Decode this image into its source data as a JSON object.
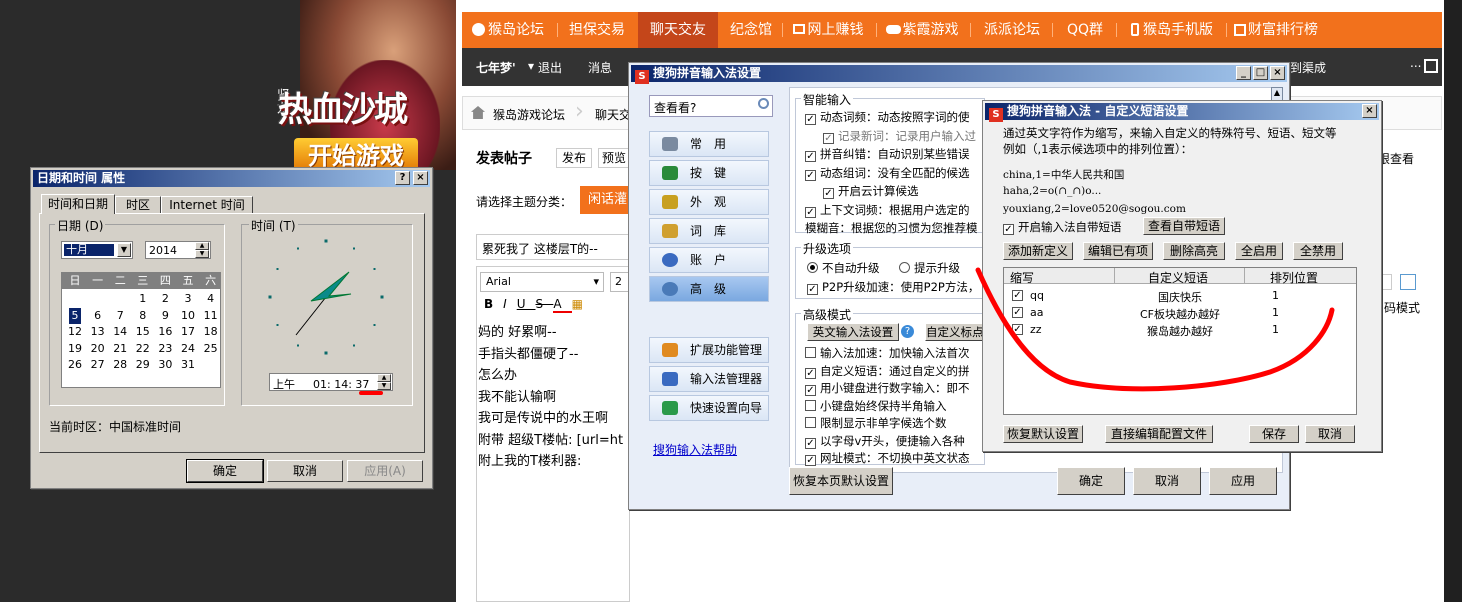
{
  "banner": {
    "game_logo": "热血沙城",
    "game_logo_prefix": "贤龙",
    "start_button": "开始游戏"
  },
  "forum": {
    "nav": [
      "猴岛论坛",
      "担保交易",
      "聊天交友",
      "纪念馆",
      "网上赚钱",
      "紫霞游戏",
      "派派论坛",
      "QQ群",
      "猴岛手机版",
      "财富排行榜"
    ],
    "active_nav": "聊天交友",
    "user": {
      "name": "七年梦'",
      "logout": "退出",
      "messages": "消息",
      "extra": "到渠成",
      "ellipsis": "..."
    },
    "breadcrumb": [
      "猴岛游戏论坛",
      "聊天交"
    ],
    "post_title_label": "发表帖子",
    "publish_btn": "发布",
    "preview_btn": "预览",
    "perm_view": "限查看",
    "category_label": "请选择主题分类：",
    "category_value": "闲话灌",
    "subject": "累死我了 这楼层T的-- ",
    "font_name": "Arial",
    "font_size": "2",
    "code_mode": "码模式",
    "body_lines": [
      "妈的 好累啊--",
      "手指头都僵硬了--",
      "怎么办",
      "我不能认输啊",
      "我可是传说中的水王啊",
      "附带 超级T楼帖: [url=ht",
      "附上我的T楼利器:"
    ]
  },
  "datetime_window": {
    "title": "日期和时间 属性",
    "tabs": [
      "时间和日期",
      "时区",
      "Internet 时间"
    ],
    "date_label": "日期 (D)",
    "time_label": "时间 (T)",
    "month": "十月",
    "year": "2014",
    "weekdays": [
      "日",
      "一",
      "二",
      "三",
      "四",
      "五",
      "六"
    ],
    "days": [
      "1",
      "2",
      "3",
      "4",
      "5",
      "6",
      "7",
      "8",
      "9",
      "10",
      "11",
      "12",
      "13",
      "14",
      "15",
      "16",
      "17",
      "18",
      "19",
      "20",
      "21",
      "22",
      "23",
      "24",
      "25",
      "26",
      "27",
      "28",
      "29",
      "30",
      "31"
    ],
    "selected_day": "5",
    "ampm": "上午",
    "time": "01: 14: 37",
    "timezone": "当前时区：中国标准时间",
    "ok": "确定",
    "cancel": "取消",
    "apply": "应用(A)"
  },
  "sogou_settings": {
    "title": "搜狗拼音输入法设置",
    "search_placeholder": "查看看?",
    "sections": [
      "常用",
      "按键",
      "外观",
      "词库",
      "账户",
      "高级"
    ],
    "selected_section": "高级",
    "extra_items": [
      "扩展功能管理",
      "输入法管理器",
      "快速设置向导"
    ],
    "help_link": "搜狗输入法帮助",
    "smart_input_label": "智能输入",
    "smart_input": [
      {
        "checked": true,
        "text": "动态词频：动态按照字词的使"
      },
      {
        "checked": true,
        "indent": true,
        "text": "记录新词：记录用户输入过"
      },
      {
        "checked": true,
        "text": "拼音纠错：自动识别某些错误"
      },
      {
        "checked": true,
        "text": "动态组词：没有全匹配的候选"
      },
      {
        "checked": true,
        "indent": true,
        "text": "开启云计算候选"
      },
      {
        "checked": true,
        "text": "上下文词频：根据用户选定的"
      },
      {
        "checked": false,
        "text": "模糊音：根据您的习惯为您推荐模"
      }
    ],
    "upgrade_label": "升级选项",
    "upgrade_options": [
      "不自动升级",
      "提示升级"
    ],
    "p2p": "P2P升级加速：使用P2P方法，",
    "advanced_label": "高级模式",
    "adv_buttons": [
      "英文输入法设置",
      "自定义标点"
    ],
    "advanced": [
      {
        "checked": false,
        "text": "输入法加速：加快输入法首次"
      },
      {
        "checked": true,
        "text": "自定义短语：通过自定义的拼"
      },
      {
        "checked": true,
        "text": "用小键盘进行数字输入：即不"
      },
      {
        "checked": false,
        "text": "小键盘始终保持半角输入"
      },
      {
        "checked": false,
        "text": "限制显示非单字候选个数"
      },
      {
        "checked": true,
        "text": "以字母v开头，便捷输入各种"
      },
      {
        "checked": true,
        "text": "网址模式：不切换中英文状态"
      }
    ],
    "restore": "恢复本页默认设置",
    "ok": "确定",
    "cancel": "取消",
    "apply": "应用"
  },
  "phrase_dialog": {
    "title": "搜狗拼音输入法 - 自定义短语设置",
    "desc1": "通过英文字符作为缩写，来输入自定义的特殊符号、短语、短文等",
    "desc2": "例如（,1表示候选项中的排列位置）：",
    "examples": [
      "china,1=中华人民共和国",
      "haha,2=o(∩_∩)o...",
      "youxiang,2=love0520@sogou.com"
    ],
    "enable_builtin": "开启输入法自带短语",
    "view_builtin": "查看自带短语",
    "buttons": [
      "添加新定义",
      "编辑已有项",
      "删除高亮",
      "全启用",
      "全禁用"
    ],
    "columns": [
      "缩写",
      "自定义短语",
      "排列位置"
    ],
    "rows": [
      {
        "abbr": "qq",
        "phrase": "国庆快乐",
        "pos": "1"
      },
      {
        "abbr": "aa",
        "phrase": "CF板块越办越好",
        "pos": "1"
      },
      {
        "abbr": "zz",
        "phrase": "猴岛越办越好",
        "pos": "1"
      }
    ],
    "restore": "恢复默认设置",
    "edit_file": "直接编辑配置文件",
    "save": "保存",
    "cancel": "取消"
  },
  "colors": {
    "forum_orange": "#f2711c",
    "title_blue": "#0a246a",
    "annotation_red": "#ff0000"
  }
}
